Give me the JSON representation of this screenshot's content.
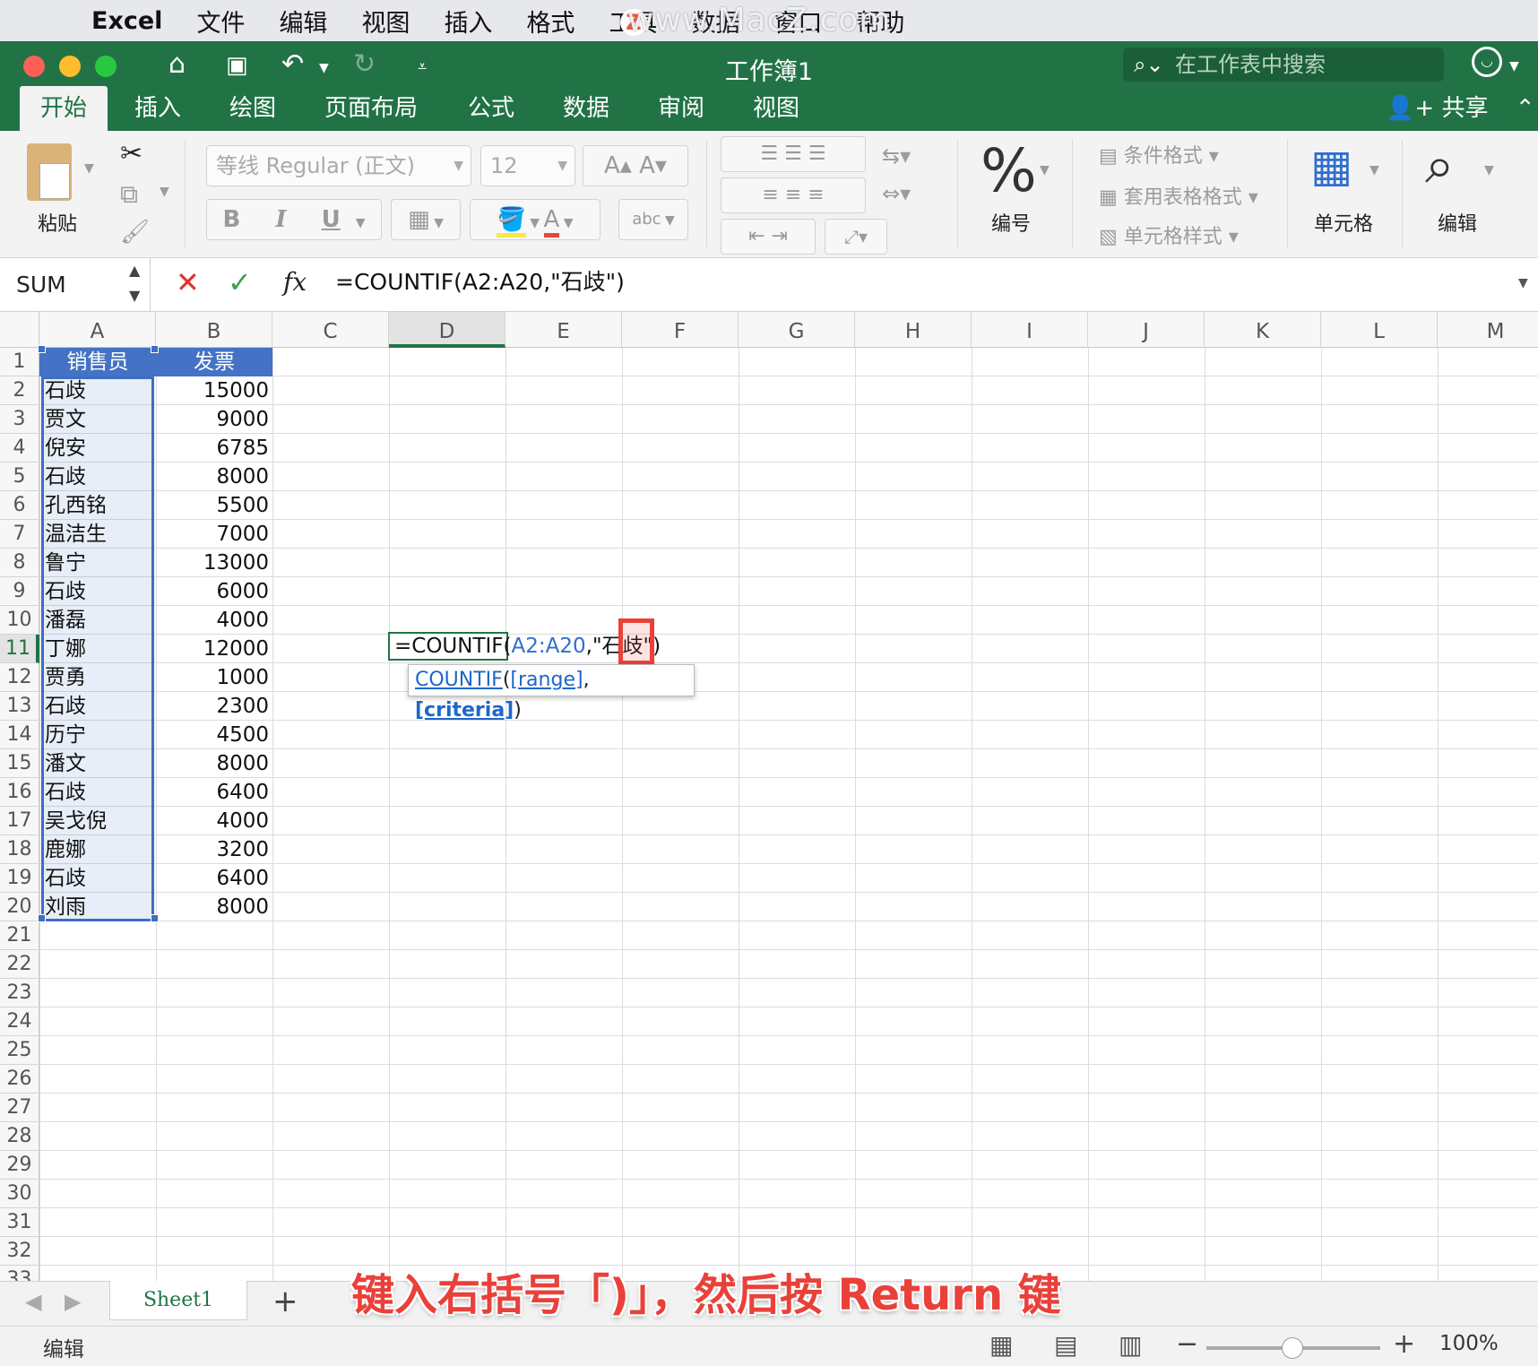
{
  "menubar": {
    "app": "Excel",
    "items": [
      "文件",
      "编辑",
      "视图",
      "插入",
      "格式",
      "工具",
      "数据",
      "窗口",
      "帮助"
    ],
    "watermark": "www.MacZ.com"
  },
  "window": {
    "title": "工作簿1",
    "search_placeholder": "在工作表中搜索",
    "share": "共享"
  },
  "ribbon": {
    "tabs": [
      "开始",
      "插入",
      "绘图",
      "页面布局",
      "公式",
      "数据",
      "审阅",
      "视图"
    ],
    "paste": "粘贴",
    "font_name": "等线 Regular (正文)",
    "font_size": "12",
    "bold": "B",
    "italic": "I",
    "underline": "U",
    "number": "编号",
    "conditional_format": "条件格式",
    "format_as_table": "套用表格格式",
    "cell_styles": "单元格样式",
    "cells": "单元格",
    "editing": "编辑"
  },
  "formula_bar": {
    "name_box": "SUM",
    "formula": "=COUNTIF(A2:A20,\"石歧\")"
  },
  "columns": [
    "A",
    "B",
    "C",
    "D",
    "E",
    "F",
    "G",
    "H",
    "I",
    "J",
    "K",
    "L",
    "M"
  ],
  "table": {
    "headers": [
      "销售员",
      "发票"
    ],
    "rows": [
      [
        "石歧",
        "15000"
      ],
      [
        "贾文",
        "9000"
      ],
      [
        "倪安",
        "6785"
      ],
      [
        "石歧",
        "8000"
      ],
      [
        "孔西铭",
        "5500"
      ],
      [
        "温洁生",
        "7000"
      ],
      [
        "鲁宁",
        "13000"
      ],
      [
        "石歧",
        "6000"
      ],
      [
        "潘磊",
        "4000"
      ],
      [
        "丁娜",
        "12000"
      ],
      [
        "贾勇",
        "1000"
      ],
      [
        "石歧",
        "2300"
      ],
      [
        "历宁",
        "4500"
      ],
      [
        "潘文",
        "8000"
      ],
      [
        "石歧",
        "6400"
      ],
      [
        "吴戈倪",
        "4000"
      ],
      [
        "鹿娜",
        "3200"
      ],
      [
        "石歧",
        "6400"
      ],
      [
        "刘雨",
        "8000"
      ]
    ]
  },
  "editing_cell": {
    "prefix": "=COUNTIF(",
    "range": "A2:A20",
    "suffix": ",\"石歧\")"
  },
  "tooltip": {
    "func": "COUNTIF",
    "arg1": "[range]",
    "arg2": "[criteria]"
  },
  "sheet_tab": "Sheet1",
  "caption": "键入右括号「)」，然后按 Return 键",
  "status": {
    "mode": "编辑",
    "zoom": "100%"
  },
  "colors": {
    "excel_green": "#217346",
    "selection_blue": "#3b6fc4",
    "highlight_red": "#e9413a"
  }
}
